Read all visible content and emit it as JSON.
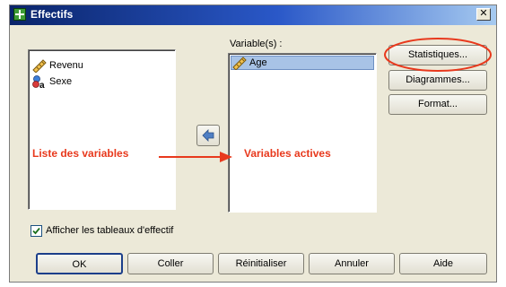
{
  "window": {
    "title": "Effectifs",
    "close_glyph": "✕"
  },
  "source_list": {
    "items": [
      {
        "label": "Revenu",
        "icon": "ruler-scale-icon"
      },
      {
        "label": "Sexe",
        "icon": "nominal-variable-icon"
      }
    ]
  },
  "target": {
    "label": "Variable(s) :",
    "items": [
      {
        "label": "Age",
        "icon": "ruler-scale-icon",
        "selected": true
      }
    ]
  },
  "side_buttons": {
    "statistics": "Statistiques...",
    "charts": "Diagrammes...",
    "format": "Format..."
  },
  "annotations": {
    "left": "Liste des variables",
    "right": "Variables actives",
    "color": "#e8391d"
  },
  "checkbox": {
    "label": "Afficher les tableaux d'effectif",
    "checked": true
  },
  "bottom_buttons": {
    "ok": "OK",
    "paste": "Coller",
    "reset": "Réinitialiser",
    "cancel": "Annuler",
    "help": "Aide"
  }
}
